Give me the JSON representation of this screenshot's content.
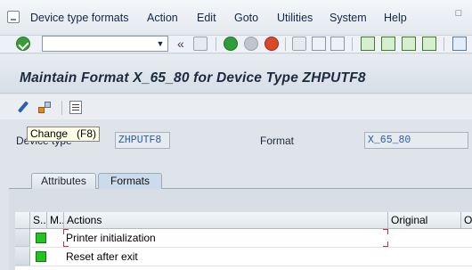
{
  "menu": {
    "items": [
      {
        "label": "Device type formats"
      },
      {
        "label": "Action"
      },
      {
        "label": "Edit"
      },
      {
        "label": "Goto"
      },
      {
        "label": "Utilities"
      },
      {
        "label": "System"
      },
      {
        "label": "Help"
      }
    ]
  },
  "toolbar": {
    "command_field_value": "",
    "chevron": "«"
  },
  "page": {
    "title": "Maintain Format X_65_80 for Device Type ZHPUTF8"
  },
  "tooltip": {
    "text": "Change   (F8)"
  },
  "fields": {
    "device_type_label": "Device type",
    "device_type_value": "ZHPUTF8",
    "format_label": "Format",
    "format_value": "X_65_80"
  },
  "tabs": [
    {
      "label": "Attributes",
      "active": false
    },
    {
      "label": "Formats",
      "active": true
    }
  ],
  "table": {
    "columns": [
      "S..",
      "M..",
      "Actions",
      "Original",
      "O"
    ],
    "rows": [
      {
        "status": "green",
        "action": "Printer initialization"
      },
      {
        "status": "green",
        "action": "Reset after exit"
      }
    ]
  },
  "colors": {
    "title_text": "#1b2a3d",
    "field_text": "#2c5aa0",
    "status_green": "#22c322",
    "focus_marker": "#d42a2a"
  }
}
